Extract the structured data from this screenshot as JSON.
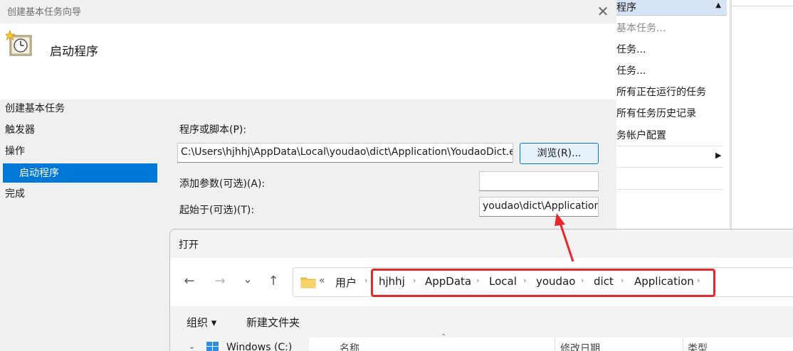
{
  "background_panel": {
    "header_label": "程序",
    "actions": [
      "基本任务...",
      "任务...",
      "任务...",
      "所有正在运行的任务",
      "所有任务历史记录",
      "务帐户配置"
    ]
  },
  "wizard": {
    "window_title": "创建基本任务向导",
    "close_glyph": "✕",
    "heading": "启动程序",
    "nav": {
      "items": [
        "创建基本任务",
        "触发器",
        "操作",
        "启动程序",
        "完成"
      ]
    },
    "fields": {
      "program_label": "程序或脚本(P):",
      "program_value": "C:\\Users\\hjhhj\\AppData\\Local\\youdao\\dict\\Application\\YoudaoDict.exe",
      "browse_label": "浏览(R)...",
      "args_label": "添加参数(可选)(A):",
      "args_value": "",
      "start_in_label": "起始于(可选)(T):",
      "start_in_value": "youdao\\dict\\Application"
    }
  },
  "open_dialog": {
    "title": "打开",
    "nav": {
      "back": "←",
      "forward": "→",
      "recent": "⌄",
      "up": "↑"
    },
    "address": {
      "overflow": "«",
      "breadcrumbs": [
        "用户",
        "hjhhj",
        "AppData",
        "Local",
        "youdao",
        "dict",
        "Application"
      ],
      "separator": "›"
    },
    "toolbar": {
      "organize": "组织 ▾",
      "new_folder": "新建文件夹"
    },
    "tree": {
      "expander": "⌄",
      "item": "Windows (C:)"
    },
    "columns": [
      "名称",
      "修改日期",
      "类型"
    ]
  },
  "colors": {
    "selection": "#0078d7",
    "callout": "#e8262c",
    "header_band": "#d6e4f5"
  }
}
